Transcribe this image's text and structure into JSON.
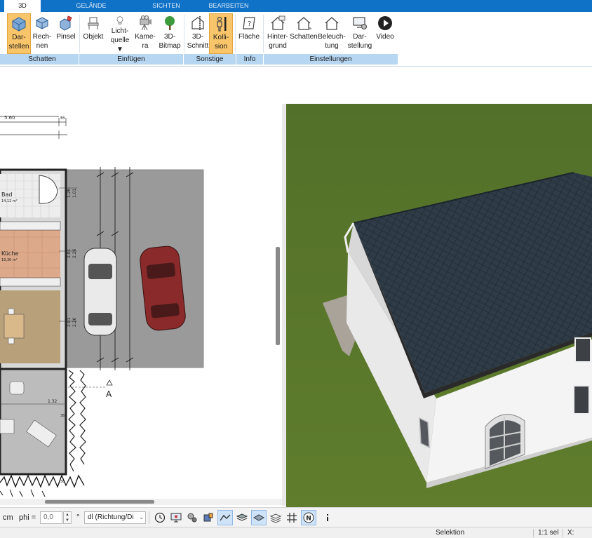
{
  "tabs": [
    {
      "label": "3D",
      "active": true
    },
    {
      "label": "GELÄNDE",
      "active": false
    },
    {
      "label": "SICHTEN",
      "active": false
    },
    {
      "label": "BEARBEITEN",
      "active": false
    }
  ],
  "ribbon": {
    "buttons": {
      "darstellen": {
        "line1": "Dar-",
        "line2": "stellen",
        "icon": "cube-render-icon",
        "active": true
      },
      "rechnen": {
        "line1": "Rech-",
        "line2": "nen",
        "icon": "cube-calc-icon"
      },
      "pinsel": {
        "line1": "Pinsel",
        "line2": "",
        "icon": "brush-cube-icon"
      },
      "objekt": {
        "line1": "Objekt",
        "line2": "",
        "icon": "chair-icon"
      },
      "lichtquelle": {
        "line1": "Licht-",
        "line2": "quelle ▼",
        "icon": "lightbulb-icon"
      },
      "kamera": {
        "line1": "Kame-",
        "line2": "ra",
        "icon": "camera-icon"
      },
      "bitmap": {
        "line1": "3D-",
        "line2": "Bitmap",
        "icon": "tree-icon"
      },
      "schnitt": {
        "line1": "3D-",
        "line2": "Schnitt",
        "icon": "section-cut-icon"
      },
      "kollision": {
        "line1": "Kolli-",
        "line2": "sion",
        "icon": "person-collision-icon",
        "active": true
      },
      "flaeche": {
        "line1": "Fläche",
        "line2": "",
        "icon": "area-info-icon"
      },
      "hintergrund": {
        "line1": "Hinter-",
        "line2": "grund",
        "icon": "house-background-icon"
      },
      "schatten": {
        "line1": "Schatten",
        "line2": "",
        "icon": "house-shadow-icon"
      },
      "beleuchtung": {
        "line1": "Beleuch-",
        "line2": "tung",
        "icon": "house-light-icon"
      },
      "darstellung": {
        "line1": "Dar-",
        "line2": "stellung",
        "icon": "monitor-settings-icon"
      },
      "video": {
        "line1": "Video",
        "line2": "",
        "icon": "play-circle-icon"
      }
    },
    "groups": {
      "schatten": "Schatten",
      "einfuegen": "Einfügen",
      "sonstige": "Sonstige",
      "info": "Info",
      "einstellungen": "Einstellungen"
    }
  },
  "plan": {
    "dim_top": "5.60",
    "dim_top_right": "36",
    "rooms": {
      "bad": {
        "name": "Bad",
        "area": "14,12 m²"
      },
      "kueche": {
        "name": "Küche",
        "area": "19,30 m²"
      }
    },
    "dims": {
      "d1": "1.26",
      "d2": "1.01",
      "d3": "2.01",
      "d4": "2.26",
      "d5": "2.01",
      "d6": "2.26",
      "d7": "1.32",
      "d8": "36",
      "d9": "36"
    },
    "section_marker": "A"
  },
  "inputbar": {
    "unit": "cm",
    "phi_label": "phi =",
    "phi_value": "0,0",
    "degree": "°",
    "direction_combo": "dl (Richtung/Di",
    "tools": [
      {
        "icon": "clock-icon"
      },
      {
        "icon": "screen-icon"
      },
      {
        "icon": "object-settings-icon"
      },
      {
        "icon": "paint-icon"
      },
      {
        "icon": "terrain-view-icon",
        "active": true
      },
      {
        "icon": "texture-icon"
      },
      {
        "icon": "layer-plane-icon",
        "active": true
      },
      {
        "icon": "layers-icon"
      },
      {
        "icon": "grid-icon"
      },
      {
        "icon": "north-icon",
        "label": "N",
        "active": true
      },
      {
        "icon": "more-icon"
      }
    ]
  },
  "statusbar": {
    "mode": "Selektion",
    "scale": "1:1 sel",
    "coord_label": "X:"
  },
  "colors": {
    "tab_bar": "#0f72c7",
    "ribbon_group": "#b6d6f2",
    "active_button": "#f9c56a",
    "grass": "#5c7a2a",
    "roof": "#2e3a44",
    "wall": "#f2f2f2"
  }
}
